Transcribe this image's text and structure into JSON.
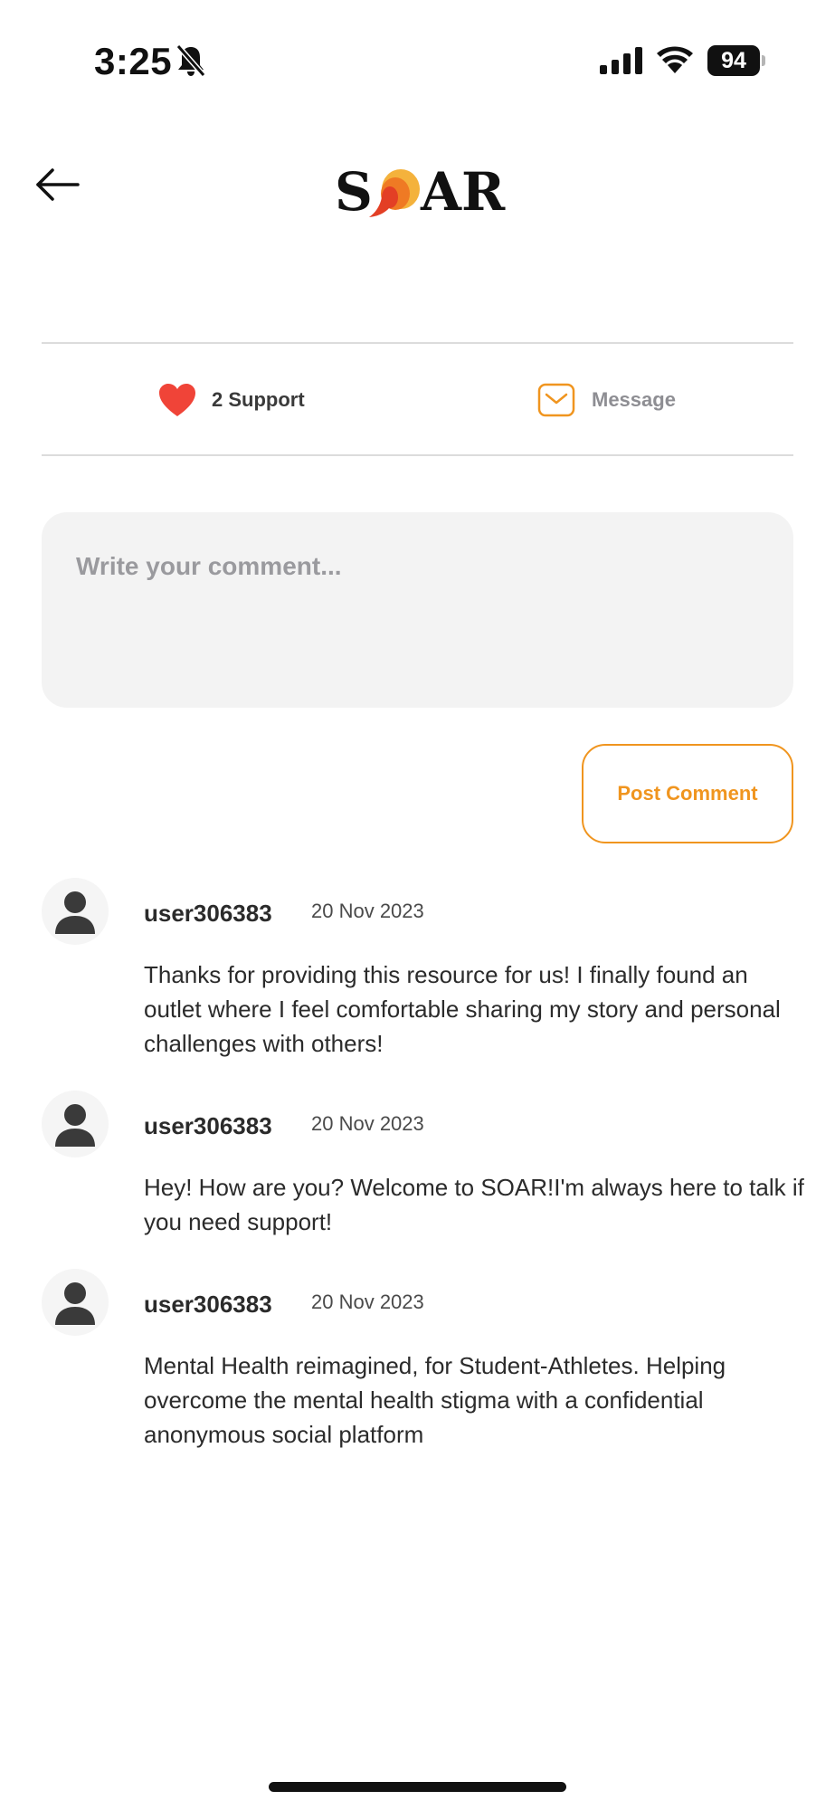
{
  "status_bar": {
    "time": "3:25",
    "battery": "94"
  },
  "header": {
    "logo_text": "SOAR"
  },
  "actions": {
    "support_label": "2 Support",
    "message_label": "Message"
  },
  "comment_input": {
    "placeholder": "Write your comment...",
    "value": ""
  },
  "post_button_label": "Post Comment",
  "comments": [
    {
      "username": "user306383",
      "date": "20 Nov 2023",
      "text": "Thanks for providing this resource for us! I finally found an outlet where I feel comfortable sharing my story and personal challenges with others!"
    },
    {
      "username": "user306383",
      "date": "20 Nov 2023",
      "text": "Hey! How are you? Welcome to SOAR!I'm always here to talk if you need support!"
    },
    {
      "username": "user306383",
      "date": "20 Nov 2023",
      "text": "Mental Health reimagined, for Student-Athletes. Helping overcome the mental health stigma with a confidential anonymous social platform"
    }
  ],
  "colors": {
    "accent": "#f0951f",
    "heart": "#f04438",
    "divider": "#dcdcdc",
    "input_background": "#f3f3f3"
  },
  "icons": [
    "bell-slash-icon",
    "cellular-signal-icon",
    "wifi-icon",
    "back-arrow-icon",
    "heart-icon",
    "envelope-icon",
    "person-icon"
  ]
}
